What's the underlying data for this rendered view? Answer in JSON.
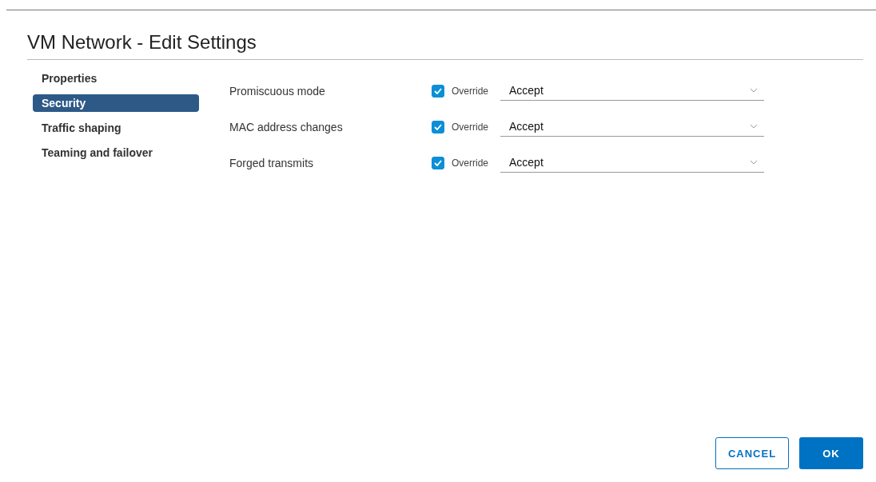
{
  "dialog": {
    "title": "VM Network - Edit Settings"
  },
  "sidebar": {
    "items": [
      {
        "label": "Properties",
        "selected": false
      },
      {
        "label": "Security",
        "selected": true
      },
      {
        "label": "Traffic shaping",
        "selected": false
      },
      {
        "label": "Teaming and failover",
        "selected": false
      }
    ]
  },
  "settings": [
    {
      "label": "Promiscuous mode",
      "override_label": "Override",
      "checked": true,
      "value": "Accept"
    },
    {
      "label": "MAC address changes",
      "override_label": "Override",
      "checked": true,
      "value": "Accept"
    },
    {
      "label": "Forged transmits",
      "override_label": "Override",
      "checked": true,
      "value": "Accept"
    }
  ],
  "buttons": [
    {
      "label": "CANCEL",
      "kind": "secondary"
    },
    {
      "label": "OK",
      "kind": "primary"
    }
  ]
}
